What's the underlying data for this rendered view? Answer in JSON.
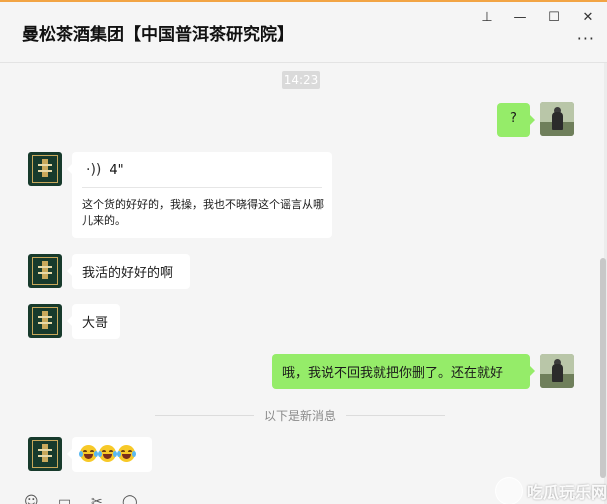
{
  "window": {
    "title": "曼松茶酒集团【中国普洱茶研究院】",
    "pin_icon": "pin-icon",
    "minimize_icon": "minimize-icon",
    "maximize_icon": "maximize-icon",
    "close_icon": "close-icon",
    "pin_glyph": "⊥",
    "minimize_glyph": "—",
    "maximize_glyph": "☐",
    "close_glyph": "✕",
    "more_glyph": "···"
  },
  "chat": {
    "timestamp": "14:23",
    "messages": [
      {
        "sender": "self",
        "type": "text",
        "text": "?"
      },
      {
        "sender": "other",
        "type": "voice",
        "duration": "4\"",
        "transcript": "这个货的好好的，我操，我也不晓得这个谣言从哪儿来的。"
      },
      {
        "sender": "other",
        "type": "text",
        "text": "我活的好好的啊"
      },
      {
        "sender": "other",
        "type": "text",
        "text": "大哥"
      },
      {
        "sender": "self",
        "type": "text",
        "text": "哦，我说不回我就把你删了。还在就好"
      },
      {
        "sender": "other",
        "type": "emoji",
        "emoji": "grinning-sweat-emoji",
        "count": 3
      }
    ],
    "new_messages_divider": "以下是新消息"
  },
  "toolbar": {
    "emoji_icon": "emoji-icon",
    "folder_icon": "folder-icon",
    "scissors_icon": "scissors-icon",
    "chat-bubble_icon": "chat-bubble-icon"
  },
  "watermark": {
    "text": "吃瓜玩乐网"
  },
  "colors": {
    "accent_bar": "#f2a444",
    "self_bubble": "#95ec69",
    "other_bubble": "#ffffff",
    "background": "#f5f5f5"
  }
}
